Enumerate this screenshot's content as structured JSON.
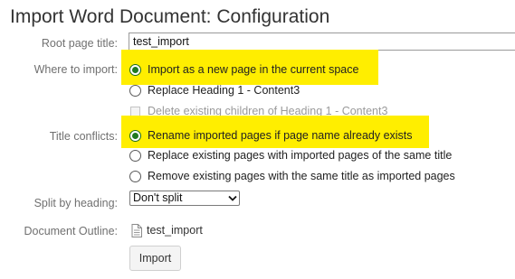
{
  "page": {
    "title": "Import Word Document: Configuration"
  },
  "form": {
    "root_page": {
      "label": "Root page title:",
      "value": "test_import"
    },
    "where_to_import": {
      "label": "Where to import:",
      "options": [
        {
          "label": "Import as a new page in the current space",
          "selected": true
        },
        {
          "label": "Replace Heading 1 - Content3",
          "selected": false
        }
      ],
      "delete_children": {
        "label": "Delete existing children of Heading 1 - Content3",
        "checked": false,
        "disabled": true
      }
    },
    "title_conflicts": {
      "label": "Title conflicts:",
      "options": [
        {
          "label": "Rename imported pages if page name already exists",
          "selected": true
        },
        {
          "label": "Replace existing pages with imported pages of the same title",
          "selected": false
        },
        {
          "label": "Remove existing pages with the same title as imported pages",
          "selected": false
        }
      ]
    },
    "split_by_heading": {
      "label": "Split by heading:",
      "selected": "Don't split"
    },
    "document_outline": {
      "label": "Document Outline:",
      "item": "test_import",
      "icon": "document-icon"
    },
    "import_button": "Import"
  },
  "colors": {
    "highlight": "#ffee00",
    "radio_selected": "#1f7a1f",
    "label": "#707070"
  }
}
